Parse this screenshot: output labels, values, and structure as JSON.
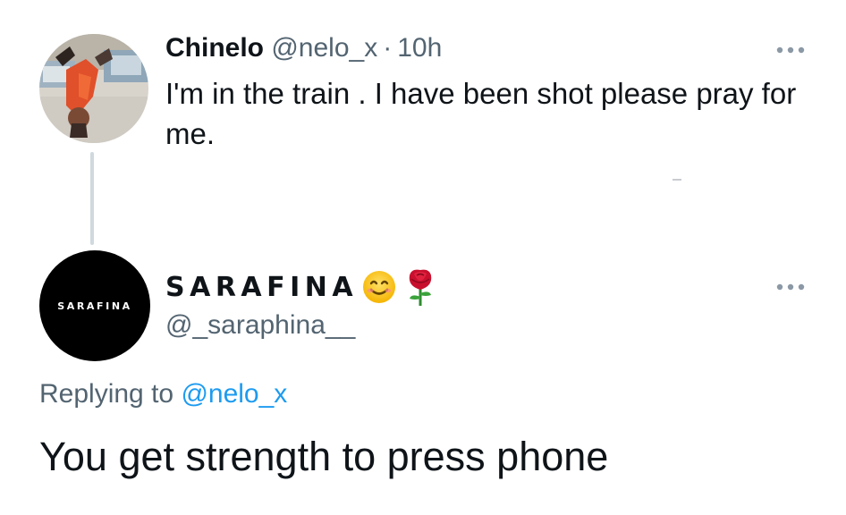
{
  "tweet1": {
    "display_name": "Chinelo",
    "handle": "@nelo_x",
    "separator": "·",
    "time": "10h",
    "text": "I'm in the train .  I have been shot please pray for me.",
    "avatar_icon": "profile-photo"
  },
  "tweet2": {
    "display_name": "SARAFINA",
    "name_emojis": [
      "smiling-face-icon",
      "rose-icon"
    ],
    "handle": "@_saraphina__",
    "avatar_text": "SARAFINA",
    "replying_to_prefix": "Replying to",
    "replying_to_handle": "@nelo_x",
    "text": "You get strength to press phone"
  },
  "icons": {
    "more_options": "more-options-icon"
  },
  "colors": {
    "text_primary": "#0f1419",
    "text_secondary": "#536471",
    "link": "#1d9bf0",
    "thread_line": "#cfd9de",
    "avatar2_bg": "#000000"
  }
}
